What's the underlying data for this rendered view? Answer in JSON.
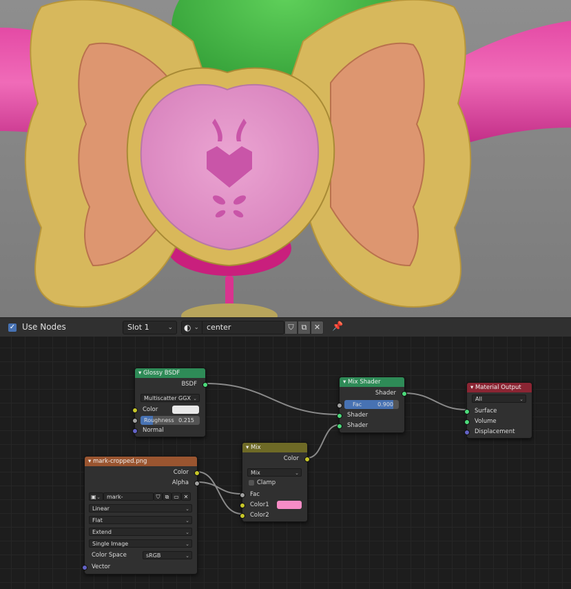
{
  "header": {
    "use_nodes_label": "Use Nodes",
    "slot": "Slot 1",
    "material_name": "center"
  },
  "nodes": {
    "glossy": {
      "title": "Glossy BSDF",
      "output": "BSDF",
      "distribution": "Multiscatter GGX",
      "color_label": "Color",
      "roughness_label": "Roughness",
      "roughness_value": "0.215",
      "roughness_fill": 0.215,
      "normal_label": "Normal",
      "header_color": "#2e8b57"
    },
    "mix_shader": {
      "title": "Mix Shader",
      "output": "Shader",
      "fac_label": "Fac",
      "fac_value": "0.900",
      "fac_fill": 0.9,
      "shader1": "Shader",
      "shader2": "Shader",
      "header_color": "#2e8b57"
    },
    "material_output": {
      "title": "Material Output",
      "target": "All",
      "surface": "Surface",
      "volume": "Volume",
      "displacement": "Displacement",
      "header_color": "#8b2533"
    },
    "mix": {
      "title": "Mix",
      "output": "Color",
      "blend": "Mix",
      "clamp_label": "Clamp",
      "fac_label": "Fac",
      "color1_label": "Color1",
      "color1_swatch": "#f78cc6",
      "color2_label": "Color2",
      "header_color": "#6e6a26"
    },
    "image": {
      "title": "mark-cropped.png",
      "out_color": "Color",
      "out_alpha": "Alpha",
      "image_name": "mark-cropped.png",
      "interpolation": "Linear",
      "projection": "Flat",
      "extension": "Extend",
      "source": "Single Image",
      "color_space_label": "Color Space",
      "color_space": "sRGB",
      "vector_label": "Vector",
      "header_color": "#9a5530"
    }
  }
}
